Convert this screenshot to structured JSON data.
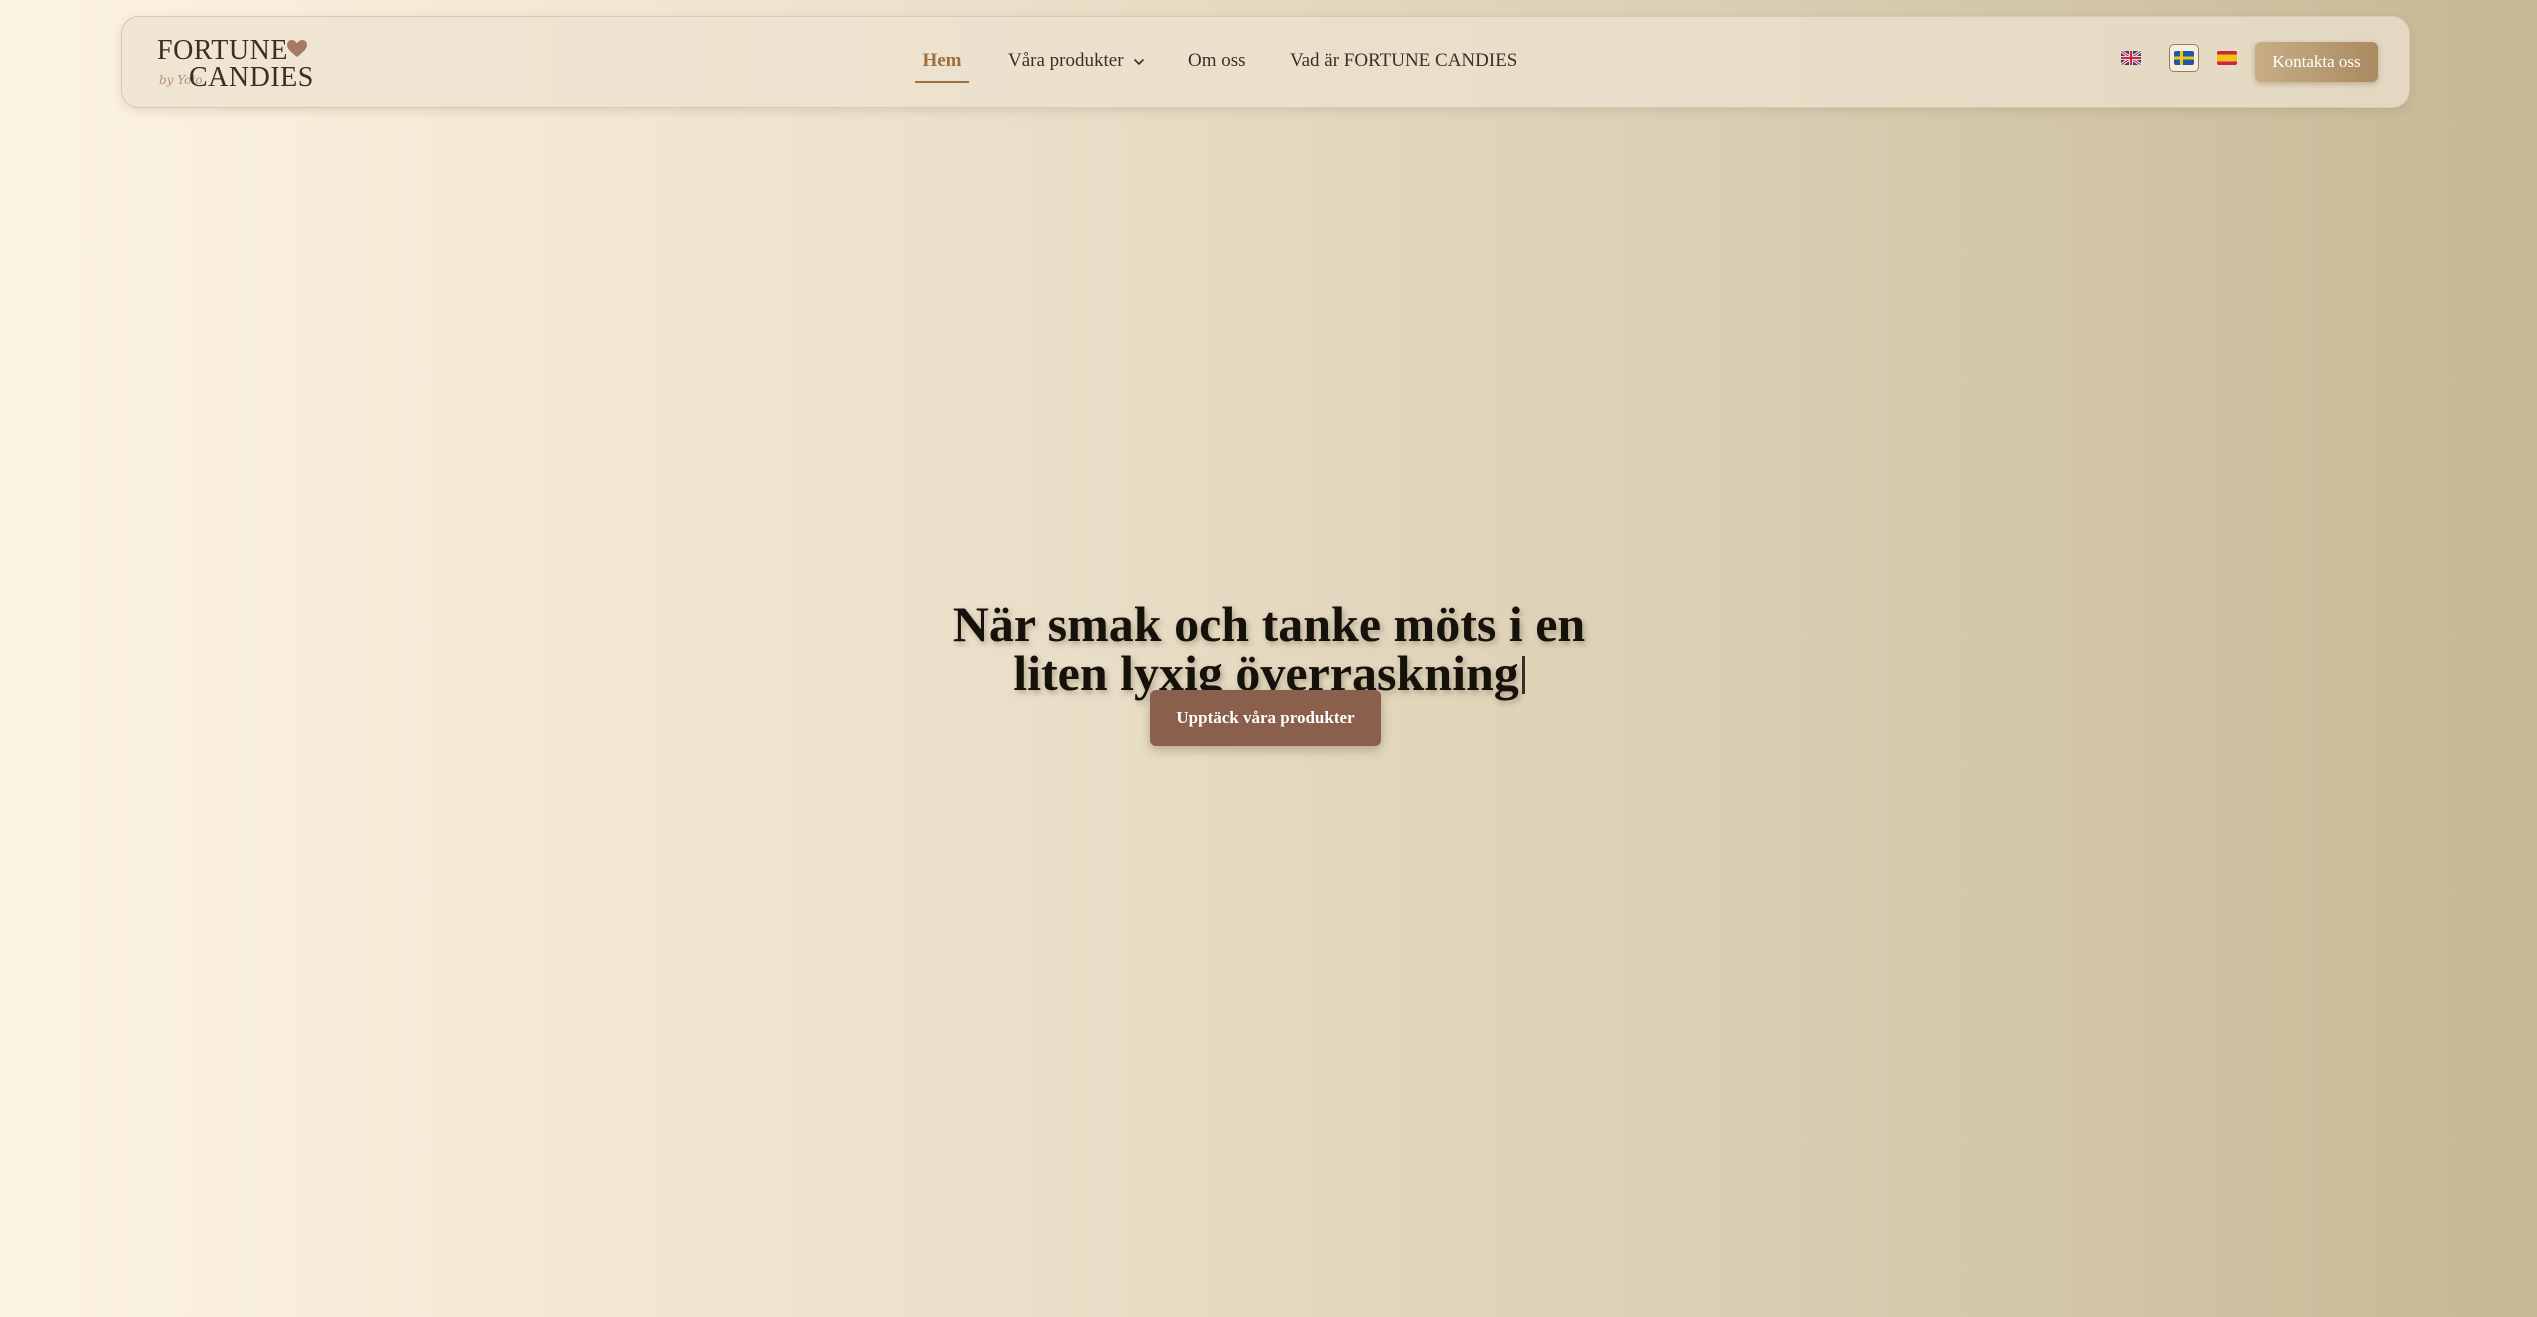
{
  "logo": {
    "top_text": "FORTUNE",
    "sub_text": "by Yolo",
    "bottom_text": "CANDIES"
  },
  "nav": {
    "items": [
      {
        "label": "Hem",
        "active": true
      },
      {
        "label": "Våra produkter",
        "has_dropdown": true
      },
      {
        "label": "Om oss"
      },
      {
        "label": "Vad är FORTUNE CANDIES"
      }
    ]
  },
  "languages": [
    {
      "code": "en",
      "icon": "uk-flag-icon"
    },
    {
      "code": "sv",
      "icon": "sweden-flag-icon",
      "selected": true
    },
    {
      "code": "es",
      "icon": "spain-flag-icon"
    }
  ],
  "header": {
    "contact_label": "Kontakta oss"
  },
  "hero": {
    "title_line1": "När smak och tanke möts i en",
    "title_line2": "liten lyxig överraskning",
    "cta_label": "Upptäck våra produkter"
  },
  "colors": {
    "accent": "#9b6f3f",
    "cta": "#8a5f4b",
    "contact_button": "#b89a72"
  }
}
